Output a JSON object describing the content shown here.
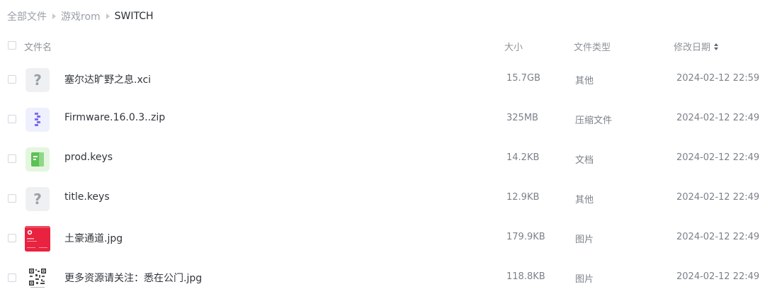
{
  "breadcrumb": {
    "items": [
      "全部文件",
      "游戏rom",
      "SWITCH"
    ]
  },
  "table": {
    "headers": {
      "name": "文件名",
      "size": "大小",
      "type": "文件类型",
      "date": "修改日期"
    },
    "rows": [
      {
        "name": "塞尔达旷野之息.xci",
        "size": "15.7GB",
        "type": "其他",
        "date": "2024-02-12 22:59",
        "icon": "unknown-file-icon"
      },
      {
        "name": "Firmware.16.0.3..zip",
        "size": "325MB",
        "type": "压缩文件",
        "date": "2024-02-12 22:49",
        "icon": "zip-file-icon"
      },
      {
        "name": "prod.keys",
        "size": "14.2KB",
        "type": "文档",
        "date": "2024-02-12 22:49",
        "icon": "document-file-icon"
      },
      {
        "name": "title.keys",
        "size": "12.9KB",
        "type": "其他",
        "date": "2024-02-12 22:49",
        "icon": "unknown-file-icon"
      },
      {
        "name": "土豪通道.jpg",
        "size": "179.9KB",
        "type": "图片",
        "date": "2024-02-12 22:49",
        "icon": "image-thumbnail-red"
      },
      {
        "name": "更多资源请关注：悉在公门.jpg",
        "size": "118.8KB",
        "type": "图片",
        "date": "2024-02-12 22:49",
        "icon": "image-thumbnail-qr"
      }
    ]
  },
  "colors": {
    "zip_accent": "#7b6cf0",
    "doc_accent": "#5cc155",
    "image_red": "#e8223f"
  }
}
